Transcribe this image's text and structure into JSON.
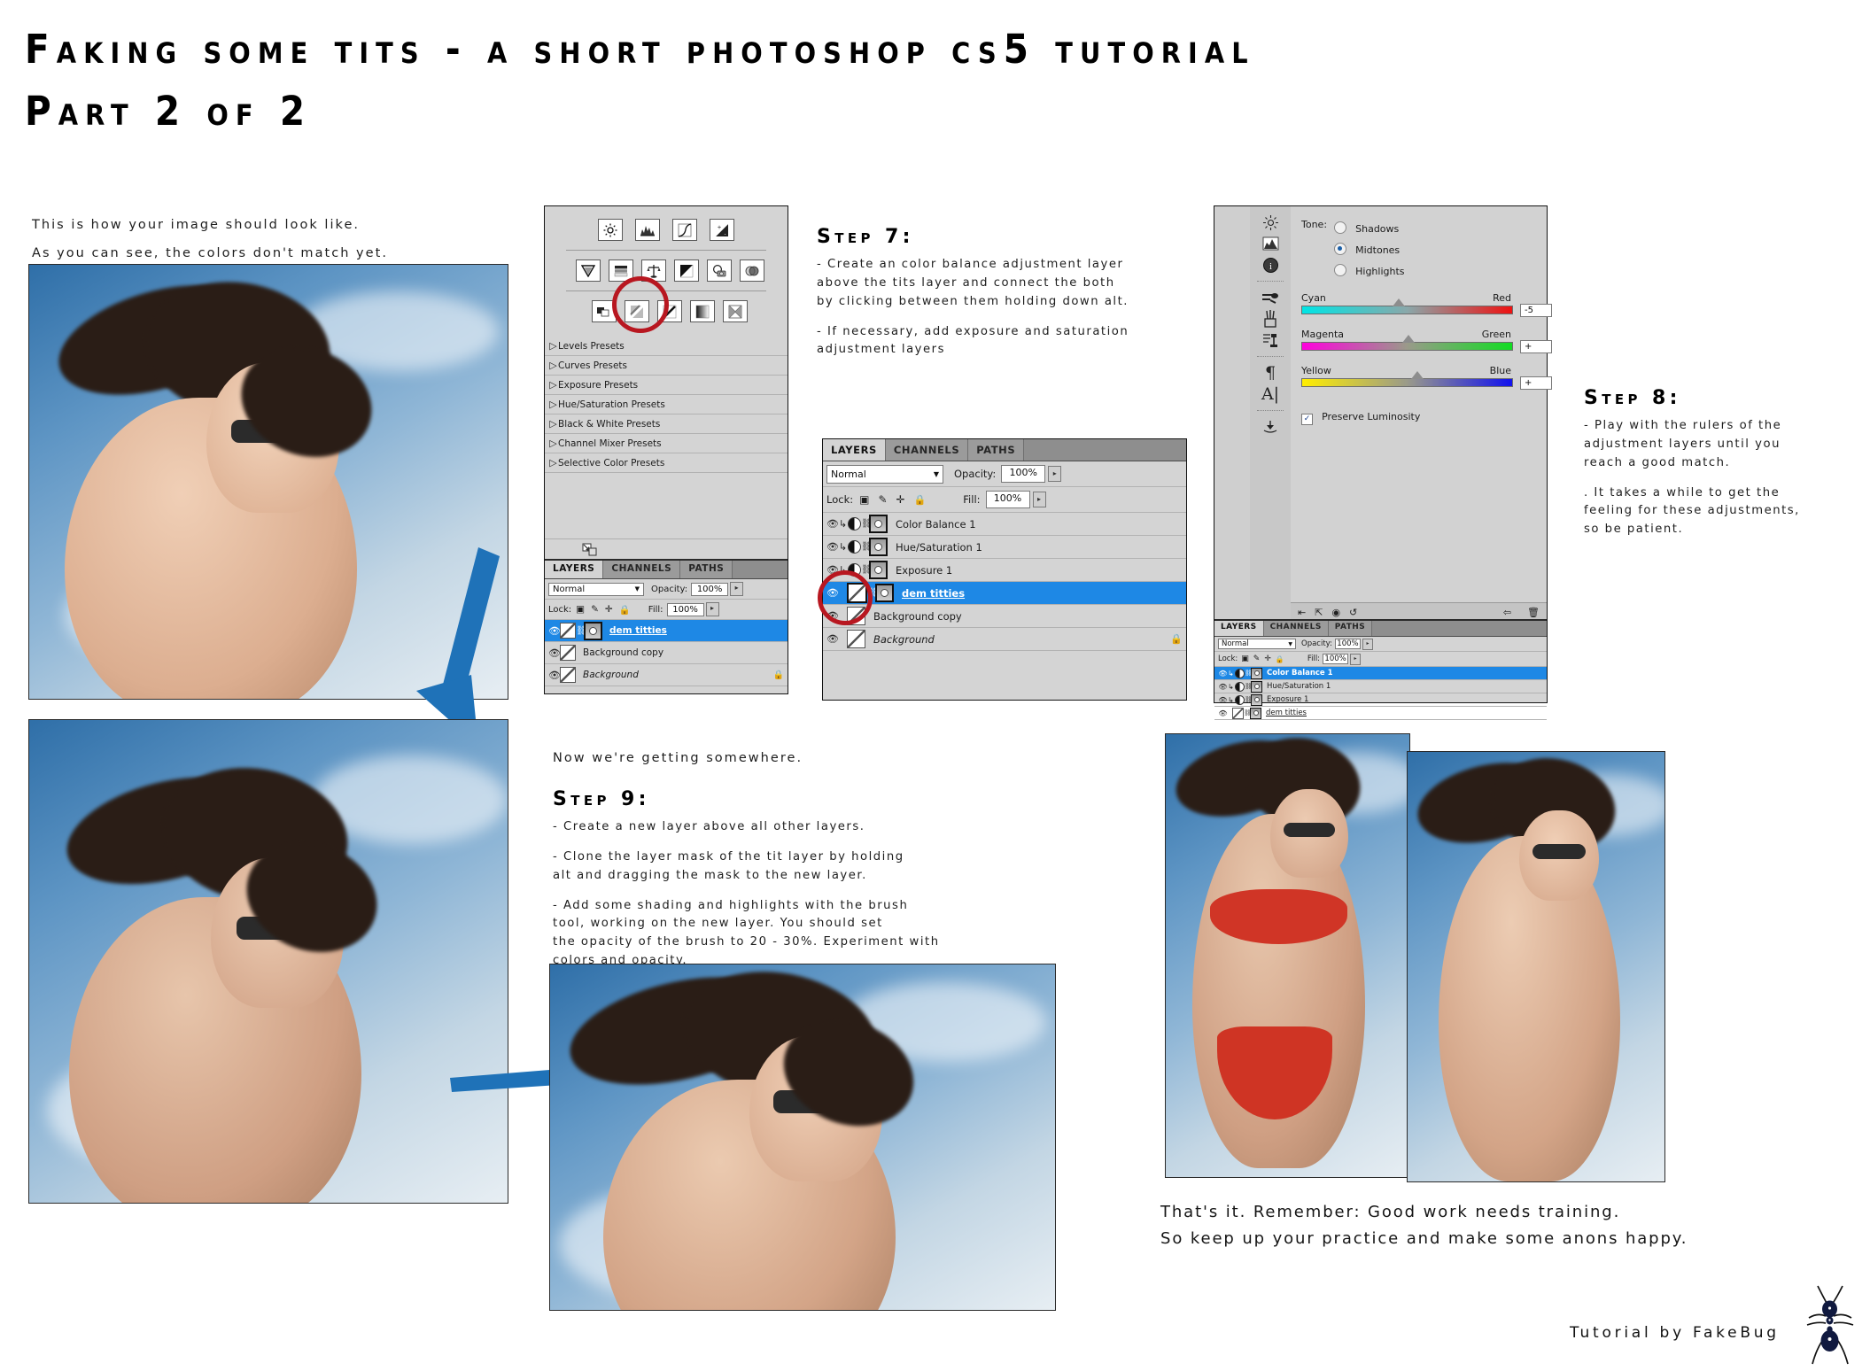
{
  "title": {
    "line1": "Faking some tits - a short photoshop cs5 tutorial",
    "line2": "Part 2 of 2"
  },
  "intro": {
    "line1": "This is how your image should look like.",
    "line2": "As you can see, the colors don't match yet."
  },
  "midnote": "Now we're getting somewhere.",
  "steps": [
    {
      "heading": "Step 7:",
      "bullets": [
        "- Create an color balance adjustment layer\n  above the tits layer and connect the both\n  by clicking between them holding down alt.",
        "- If necessary, add exposure and saturation\n  adjustment layers"
      ]
    },
    {
      "heading": "Step 8:",
      "bullets": [
        "- Play with the rulers of the\n  adjustment layers until you\n  reach a good match.",
        ". It takes a while to get the\n  feeling for these adjustments,\n  so be patient."
      ]
    },
    {
      "heading": "Step 9:",
      "bullets": [
        "- Create a new layer above all other layers.",
        "- Clone the layer mask of the tit layer by holding\n  alt and dragging the mask to the new layer.",
        "- Add some shading and highlights with the brush\n  tool, working on the new layer. You should set\n  the opacity of the brush to 20 - 30%. Experiment with\n  colors and opacity."
      ]
    }
  ],
  "closing": {
    "line1": "That's it. Remember: Good work needs training.",
    "line2": "So keep up your practice and make some anons happy."
  },
  "signature": "Tutorial by FakeBug",
  "adjustments_panel": {
    "icon_rows": [
      [
        "brightness-contrast-icon",
        "levels-icon",
        "curves-icon",
        "exposure-icon"
      ],
      [
        "vibrance-icon",
        "hue-saturation-icon",
        "color-balance-icon",
        "black-white-icon",
        "photo-filter-icon",
        "channel-mixer-icon"
      ],
      [
        "invert-icon",
        "posterize-icon",
        "threshold-icon",
        "gradient-map-icon",
        "selective-color-icon"
      ]
    ],
    "presets": [
      "Levels Presets",
      "Curves Presets",
      "Exposure Presets",
      "Hue/Saturation Presets",
      "Black & White Presets",
      "Channel Mixer Presets",
      "Selective Color Presets"
    ]
  },
  "layers_panel_small": {
    "tabs": [
      "LAYERS",
      "CHANNELS",
      "PATHS"
    ],
    "blend_mode": "Normal",
    "opacity_label": "Opacity:",
    "opacity_value": "100%",
    "lock_label": "Lock:",
    "fill_label": "Fill:",
    "fill_value": "100%",
    "layers": [
      {
        "name": "dem titties",
        "selected": true,
        "has_mask": true,
        "linked": true,
        "style": "bold-underline"
      },
      {
        "name": "Background copy",
        "selected": false,
        "has_mask": false,
        "linked": false,
        "style": "plain"
      },
      {
        "name": "Background",
        "selected": false,
        "has_mask": false,
        "linked": false,
        "style": "italic",
        "locked": true
      }
    ]
  },
  "layers_panel_main": {
    "tabs": [
      "LAYERS",
      "CHANNELS",
      "PATHS"
    ],
    "blend_mode": "Normal",
    "opacity_label": "Opacity:",
    "opacity_value": "100%",
    "lock_label": "Lock:",
    "fill_label": "Fill:",
    "fill_value": "100%",
    "layers": [
      {
        "name": "Color Balance 1",
        "selected": false,
        "adjustment": true,
        "clipped": true
      },
      {
        "name": "Hue/Saturation 1",
        "selected": false,
        "adjustment": true,
        "clipped": true
      },
      {
        "name": "Exposure 1",
        "selected": false,
        "adjustment": true,
        "clipped": true
      },
      {
        "name": "dem titties",
        "selected": true,
        "adjustment": false,
        "style": "bold-underline"
      },
      {
        "name": "Background copy",
        "selected": false,
        "adjustment": false
      },
      {
        "name": "Background",
        "selected": false,
        "adjustment": false,
        "style": "italic",
        "locked": true
      }
    ]
  },
  "layers_panel_right": {
    "tabs": [
      "LAYERS",
      "CHANNELS",
      "PATHS"
    ],
    "blend_mode": "Normal",
    "opacity_label": "Opacity:",
    "opacity_value": "100%",
    "lock_label": "Lock:",
    "fill_label": "Fill:",
    "fill_value": "100%",
    "layers": [
      {
        "name": "Color Balance 1",
        "selected": true,
        "adjustment": true
      },
      {
        "name": "Hue/Saturation 1",
        "selected": false,
        "adjustment": true
      },
      {
        "name": "Exposure 1",
        "selected": false,
        "adjustment": true
      },
      {
        "name": "dem titties",
        "selected": false,
        "adjustment": false,
        "style": "underline"
      }
    ]
  },
  "color_balance": {
    "tone_label": "Tone:",
    "tones": [
      {
        "label": "Shadows",
        "selected": false
      },
      {
        "label": "Midtones",
        "selected": true
      },
      {
        "label": "Highlights",
        "selected": false
      }
    ],
    "sliders": [
      {
        "left": "Cyan",
        "right": "Red",
        "value": "-5",
        "knob_pct": 46
      },
      {
        "left": "Magenta",
        "right": "Green",
        "value": "+",
        "knob_pct": 51
      },
      {
        "left": "Yellow",
        "right": "Blue",
        "value": "+",
        "knob_pct": 55
      }
    ],
    "preserve_luminosity": "Preserve Luminosity",
    "checked": true
  },
  "right_toolbar_icons": [
    "adjustments-icon",
    "histogram-icon",
    "info-icon",
    "color-icon",
    "brushes-icon",
    "clone-source-icon",
    "paragraph-icon",
    "character-icon",
    "collapse-icon"
  ],
  "colors": {
    "arrow_blue": "#1f72b8",
    "selection_blue": "#1e88e5",
    "annotation_red": "#b81720",
    "panel_gray": "#d4d4d4",
    "text_dark": "#1e1e1e"
  }
}
